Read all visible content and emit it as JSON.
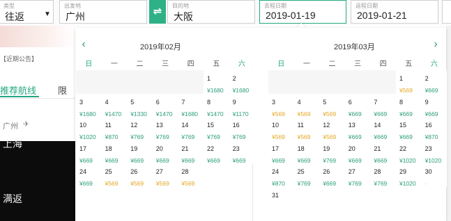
{
  "search": {
    "trip_type": {
      "label": "类型",
      "value": "往返"
    },
    "depart_city": {
      "label": "出发地",
      "value": "广州"
    },
    "arrive_city": {
      "label": "目的地",
      "value": "大阪"
    },
    "depart_date": {
      "label": "去程日期",
      "value": "2019-01-19"
    },
    "return_date": {
      "label": "返程日期",
      "value": "2019-01-21"
    },
    "swap_icon": "⇌",
    "caret_icon": "▼"
  },
  "left_page": {
    "notice": "【近期公告】",
    "tab_recommended": "推荐航线",
    "tab_other": "限",
    "route_from": "广州",
    "route_to": "上海",
    "route_type": "满返",
    "plane_icon": "✈"
  },
  "calendar": {
    "prev_icon": "‹",
    "next_icon": "›",
    "weekdays": [
      "日",
      "一",
      "二",
      "三",
      "四",
      "五",
      "六"
    ],
    "months": [
      {
        "title": "2019年02月",
        "lead_blanks": 5,
        "days": [
          {
            "d": "1",
            "p": "¥1680",
            "c": "n"
          },
          {
            "d": "2",
            "p": "¥1680",
            "c": "n"
          },
          {
            "d": "3",
            "p": "¥1680",
            "c": "n"
          },
          {
            "d": "4",
            "p": "¥1470",
            "c": "n"
          },
          {
            "d": "5",
            "p": "¥1330",
            "c": "n"
          },
          {
            "d": "6",
            "p": "¥1470",
            "c": "n"
          },
          {
            "d": "7",
            "p": "¥1680",
            "c": "n"
          },
          {
            "d": "8",
            "p": "¥1470",
            "c": "n"
          },
          {
            "d": "9",
            "p": "¥1170",
            "c": "n"
          },
          {
            "d": "10",
            "p": "¥1020",
            "c": "n"
          },
          {
            "d": "11",
            "p": "¥870",
            "c": "n"
          },
          {
            "d": "12",
            "p": "¥769",
            "c": "n"
          },
          {
            "d": "13",
            "p": "¥769",
            "c": "n"
          },
          {
            "d": "14",
            "p": "¥769",
            "c": "n"
          },
          {
            "d": "15",
            "p": "¥769",
            "c": "n"
          },
          {
            "d": "16",
            "p": "¥769",
            "c": "n"
          },
          {
            "d": "17",
            "p": "¥669",
            "c": "n"
          },
          {
            "d": "18",
            "p": "¥669",
            "c": "n"
          },
          {
            "d": "19",
            "p": "¥669",
            "c": "n"
          },
          {
            "d": "20",
            "p": "¥669",
            "c": "n"
          },
          {
            "d": "21",
            "p": "¥669",
            "c": "n"
          },
          {
            "d": "22",
            "p": "¥669",
            "c": "n"
          },
          {
            "d": "23",
            "p": "¥669",
            "c": "n"
          },
          {
            "d": "24",
            "p": "¥669",
            "c": "n"
          },
          {
            "d": "25",
            "p": "¥569",
            "c": "y"
          },
          {
            "d": "26",
            "p": "¥569",
            "c": "y"
          },
          {
            "d": "27",
            "p": "¥569",
            "c": "y"
          },
          {
            "d": "28",
            "p": "¥569",
            "c": "y"
          }
        ]
      },
      {
        "title": "2019年03月",
        "lead_blanks": 5,
        "days": [
          {
            "d": "1",
            "p": "¥569",
            "c": "y"
          },
          {
            "d": "2",
            "p": "¥669",
            "c": "n"
          },
          {
            "d": "3",
            "p": "¥569",
            "c": "y"
          },
          {
            "d": "4",
            "p": "¥569",
            "c": "y"
          },
          {
            "d": "5",
            "p": "¥569",
            "c": "y"
          },
          {
            "d": "6",
            "p": "¥669",
            "c": "n"
          },
          {
            "d": "7",
            "p": "¥669",
            "c": "n"
          },
          {
            "d": "8",
            "p": "¥669",
            "c": "n"
          },
          {
            "d": "9",
            "p": "¥669",
            "c": "n"
          },
          {
            "d": "10",
            "p": "¥569",
            "c": "y"
          },
          {
            "d": "11",
            "p": "¥569",
            "c": "y"
          },
          {
            "d": "12",
            "p": "¥569",
            "c": "y"
          },
          {
            "d": "13",
            "p": "¥669",
            "c": "n"
          },
          {
            "d": "14",
            "p": "¥669",
            "c": "n"
          },
          {
            "d": "15",
            "p": "¥669",
            "c": "n"
          },
          {
            "d": "16",
            "p": "¥870",
            "c": "n"
          },
          {
            "d": "17",
            "p": "¥669",
            "c": "n"
          },
          {
            "d": "18",
            "p": "¥669",
            "c": "n"
          },
          {
            "d": "19",
            "p": "¥769",
            "c": "n"
          },
          {
            "d": "20",
            "p": "¥669",
            "c": "n"
          },
          {
            "d": "21",
            "p": "¥669",
            "c": "n"
          },
          {
            "d": "22",
            "p": "¥1020",
            "c": "n"
          },
          {
            "d": "23",
            "p": "¥1020",
            "c": "n"
          },
          {
            "d": "24",
            "p": "¥870",
            "c": "n"
          },
          {
            "d": "25",
            "p": "¥769",
            "c": "n"
          },
          {
            "d": "26",
            "p": "¥669",
            "c": "n"
          },
          {
            "d": "27",
            "p": "¥769",
            "c": "n"
          },
          {
            "d": "28",
            "p": "¥769",
            "c": "n"
          },
          {
            "d": "29",
            "p": "¥1020",
            "c": "n"
          },
          {
            "d": "30",
            "p": "-",
            "c": "m"
          },
          {
            "d": "31",
            "p": "",
            "c": "n"
          }
        ]
      }
    ]
  },
  "colors": {
    "accent": "#24a782",
    "cheap": "#e3a621",
    "price": "#2b9d7c"
  }
}
